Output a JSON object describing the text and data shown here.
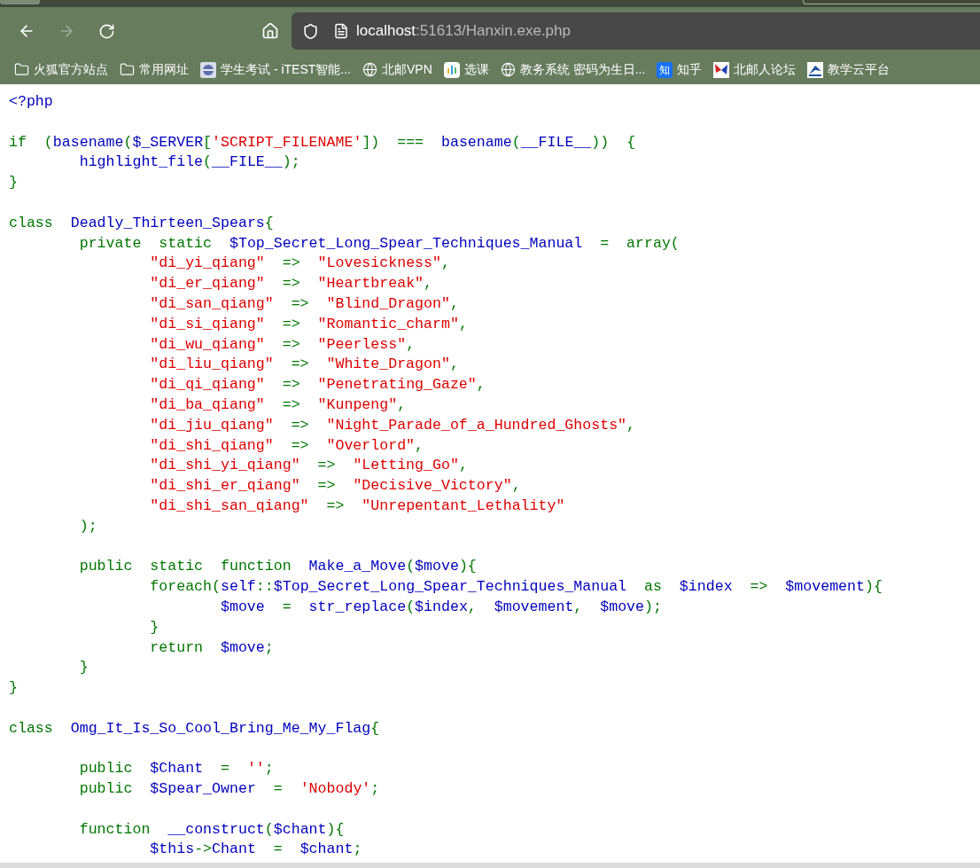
{
  "toolbar": {
    "back": {
      "disabled": false
    },
    "forward": {
      "disabled": true
    },
    "url": {
      "host": "localhost",
      "rest": ":51613/Hanxin.exe.php"
    }
  },
  "bookmarks": [
    {
      "kind": "folder",
      "label": "火狐官方站点"
    },
    {
      "kind": "folder",
      "label": "常用网址"
    },
    {
      "kind": "itest",
      "label": "学生考试 - iTEST智能..."
    },
    {
      "kind": "globe",
      "label": "北邮VPN"
    },
    {
      "kind": "bars",
      "label": "选课"
    },
    {
      "kind": "globe",
      "label": "教务系统 密码为生日..."
    },
    {
      "kind": "zhihu",
      "icon_text": "知",
      "label": "知乎"
    },
    {
      "kind": "butterfly",
      "label": "北邮人论坛"
    },
    {
      "kind": "bird",
      "label": "教学云平台"
    }
  ],
  "code_lines": [
    {
      "kind": "code",
      "tokens": [
        {
          "kind": "default",
          "text": "<?php"
        }
      ]
    },
    {
      "kind": "blank"
    },
    {
      "kind": "code",
      "tokens": [
        {
          "kind": "keyword",
          "text": "if  ("
        },
        {
          "kind": "default",
          "text": "basename"
        },
        {
          "kind": "keyword",
          "text": "("
        },
        {
          "kind": "default",
          "text": "$_SERVER"
        },
        {
          "kind": "keyword",
          "text": "["
        },
        {
          "kind": "string",
          "text": "'SCRIPT_FILENAME'"
        },
        {
          "kind": "keyword",
          "text": "])  ===  "
        },
        {
          "kind": "default",
          "text": "basename"
        },
        {
          "kind": "keyword",
          "text": "("
        },
        {
          "kind": "default",
          "text": "__FILE__"
        },
        {
          "kind": "keyword",
          "text": "))  {"
        }
      ]
    },
    {
      "kind": "code",
      "tokens": [
        {
          "kind": "default",
          "text": "\thighlight_file"
        },
        {
          "kind": "keyword",
          "text": "("
        },
        {
          "kind": "default",
          "text": "__FILE__"
        },
        {
          "kind": "keyword",
          "text": ");"
        }
      ]
    },
    {
      "kind": "code",
      "tokens": [
        {
          "kind": "keyword",
          "text": "}"
        }
      ]
    },
    {
      "kind": "blank"
    },
    {
      "kind": "code",
      "tokens": [
        {
          "kind": "keyword",
          "text": "class  "
        },
        {
          "kind": "default",
          "text": "Deadly_Thirteen_Spears"
        },
        {
          "kind": "keyword",
          "text": "{"
        }
      ]
    },
    {
      "kind": "code",
      "tokens": [
        {
          "kind": "keyword",
          "text": "\tprivate  static  "
        },
        {
          "kind": "default",
          "text": "$Top_Secret_Long_Spear_Techniques_Manual  "
        },
        {
          "kind": "keyword",
          "text": "=  array("
        }
      ]
    },
    {
      "kind": "code",
      "tokens": [
        {
          "kind": "string",
          "text": "\t\t\"di_yi_qiang\"  "
        },
        {
          "kind": "keyword",
          "text": "=>  "
        },
        {
          "kind": "string",
          "text": "\"Lovesickness\""
        },
        {
          "kind": "keyword",
          "text": ","
        }
      ]
    },
    {
      "kind": "code",
      "tokens": [
        {
          "kind": "string",
          "text": "\t\t\"di_er_qiang\"  "
        },
        {
          "kind": "keyword",
          "text": "=>  "
        },
        {
          "kind": "string",
          "text": "\"Heartbreak\""
        },
        {
          "kind": "keyword",
          "text": ","
        }
      ]
    },
    {
      "kind": "code",
      "tokens": [
        {
          "kind": "string",
          "text": "\t\t\"di_san_qiang\"  "
        },
        {
          "kind": "keyword",
          "text": "=>  "
        },
        {
          "kind": "string",
          "text": "\"Blind_Dragon\""
        },
        {
          "kind": "keyword",
          "text": ","
        }
      ]
    },
    {
      "kind": "code",
      "tokens": [
        {
          "kind": "string",
          "text": "\t\t\"di_si_qiang\"  "
        },
        {
          "kind": "keyword",
          "text": "=>  "
        },
        {
          "kind": "string",
          "text": "\"Romantic_charm\""
        },
        {
          "kind": "keyword",
          "text": ","
        }
      ]
    },
    {
      "kind": "code",
      "tokens": [
        {
          "kind": "string",
          "text": "\t\t\"di_wu_qiang\"  "
        },
        {
          "kind": "keyword",
          "text": "=>  "
        },
        {
          "kind": "string",
          "text": "\"Peerless\""
        },
        {
          "kind": "keyword",
          "text": ","
        }
      ]
    },
    {
      "kind": "code",
      "tokens": [
        {
          "kind": "string",
          "text": "\t\t\"di_liu_qiang\"  "
        },
        {
          "kind": "keyword",
          "text": "=>  "
        },
        {
          "kind": "string",
          "text": "\"White_Dragon\""
        },
        {
          "kind": "keyword",
          "text": ","
        }
      ]
    },
    {
      "kind": "code",
      "tokens": [
        {
          "kind": "string",
          "text": "\t\t\"di_qi_qiang\"  "
        },
        {
          "kind": "keyword",
          "text": "=>  "
        },
        {
          "kind": "string",
          "text": "\"Penetrating_Gaze\""
        },
        {
          "kind": "keyword",
          "text": ","
        }
      ]
    },
    {
      "kind": "code",
      "tokens": [
        {
          "kind": "string",
          "text": "\t\t\"di_ba_qiang\"  "
        },
        {
          "kind": "keyword",
          "text": "=>  "
        },
        {
          "kind": "string",
          "text": "\"Kunpeng\""
        },
        {
          "kind": "keyword",
          "text": ","
        }
      ]
    },
    {
      "kind": "code",
      "tokens": [
        {
          "kind": "string",
          "text": "\t\t\"di_jiu_qiang\"  "
        },
        {
          "kind": "keyword",
          "text": "=>  "
        },
        {
          "kind": "string",
          "text": "\"Night_Parade_of_a_Hundred_Ghosts\""
        },
        {
          "kind": "keyword",
          "text": ","
        }
      ]
    },
    {
      "kind": "code",
      "tokens": [
        {
          "kind": "string",
          "text": "\t\t\"di_shi_qiang\"  "
        },
        {
          "kind": "keyword",
          "text": "=>  "
        },
        {
          "kind": "string",
          "text": "\"Overlord\""
        },
        {
          "kind": "keyword",
          "text": ","
        }
      ]
    },
    {
      "kind": "code",
      "tokens": [
        {
          "kind": "string",
          "text": "\t\t\"di_shi_yi_qiang\"  "
        },
        {
          "kind": "keyword",
          "text": "=>  "
        },
        {
          "kind": "string",
          "text": "\"Letting_Go\""
        },
        {
          "kind": "keyword",
          "text": ","
        }
      ]
    },
    {
      "kind": "code",
      "tokens": [
        {
          "kind": "string",
          "text": "\t\t\"di_shi_er_qiang\"  "
        },
        {
          "kind": "keyword",
          "text": "=>  "
        },
        {
          "kind": "string",
          "text": "\"Decisive_Victory\""
        },
        {
          "kind": "keyword",
          "text": ","
        }
      ]
    },
    {
      "kind": "code",
      "tokens": [
        {
          "kind": "string",
          "text": "\t\t\"di_shi_san_qiang\"  "
        },
        {
          "kind": "keyword",
          "text": "=>  "
        },
        {
          "kind": "string",
          "text": "\"Unrepentant_Lethality\""
        }
      ]
    },
    {
      "kind": "code",
      "tokens": [
        {
          "kind": "keyword",
          "text": "\t);"
        }
      ]
    },
    {
      "kind": "blank"
    },
    {
      "kind": "code",
      "tokens": [
        {
          "kind": "keyword",
          "text": "\tpublic  static  function  "
        },
        {
          "kind": "default",
          "text": "Make_a_Move"
        },
        {
          "kind": "keyword",
          "text": "("
        },
        {
          "kind": "default",
          "text": "$move"
        },
        {
          "kind": "keyword",
          "text": "){"
        }
      ]
    },
    {
      "kind": "code",
      "tokens": [
        {
          "kind": "keyword",
          "text": "\t\tforeach("
        },
        {
          "kind": "default",
          "text": "self"
        },
        {
          "kind": "keyword",
          "text": "::"
        },
        {
          "kind": "default",
          "text": "$Top_Secret_Long_Spear_Techniques_Manual  "
        },
        {
          "kind": "keyword",
          "text": "as  "
        },
        {
          "kind": "default",
          "text": "$index  "
        },
        {
          "kind": "keyword",
          "text": "=>  "
        },
        {
          "kind": "default",
          "text": "$movement"
        },
        {
          "kind": "keyword",
          "text": "){"
        }
      ]
    },
    {
      "kind": "code",
      "tokens": [
        {
          "kind": "default",
          "text": "\t\t\t$move  "
        },
        {
          "kind": "keyword",
          "text": "=  "
        },
        {
          "kind": "default",
          "text": "str_replace"
        },
        {
          "kind": "keyword",
          "text": "("
        },
        {
          "kind": "default",
          "text": "$index"
        },
        {
          "kind": "keyword",
          "text": ",  "
        },
        {
          "kind": "default",
          "text": "$movement"
        },
        {
          "kind": "keyword",
          "text": ",  "
        },
        {
          "kind": "default",
          "text": "$move"
        },
        {
          "kind": "keyword",
          "text": ");"
        }
      ]
    },
    {
      "kind": "code",
      "tokens": [
        {
          "kind": "keyword",
          "text": "\t\t}"
        }
      ]
    },
    {
      "kind": "code",
      "tokens": [
        {
          "kind": "keyword",
          "text": "\t\treturn  "
        },
        {
          "kind": "default",
          "text": "$move"
        },
        {
          "kind": "keyword",
          "text": ";"
        }
      ]
    },
    {
      "kind": "code",
      "tokens": [
        {
          "kind": "keyword",
          "text": "\t}"
        }
      ]
    },
    {
      "kind": "code",
      "tokens": [
        {
          "kind": "keyword",
          "text": "}"
        }
      ]
    },
    {
      "kind": "blank"
    },
    {
      "kind": "code",
      "tokens": [
        {
          "kind": "keyword",
          "text": "class  "
        },
        {
          "kind": "default",
          "text": "Omg_It_Is_So_Cool_Bring_Me_My_Flag"
        },
        {
          "kind": "keyword",
          "text": "{"
        }
      ]
    },
    {
      "kind": "blank"
    },
    {
      "kind": "code",
      "tokens": [
        {
          "kind": "keyword",
          "text": "\tpublic  "
        },
        {
          "kind": "default",
          "text": "$Chant  "
        },
        {
          "kind": "keyword",
          "text": "=  "
        },
        {
          "kind": "string",
          "text": "''"
        },
        {
          "kind": "keyword",
          "text": ";"
        }
      ]
    },
    {
      "kind": "code",
      "tokens": [
        {
          "kind": "keyword",
          "text": "\tpublic  "
        },
        {
          "kind": "default",
          "text": "$Spear_Owner  "
        },
        {
          "kind": "keyword",
          "text": "=  "
        },
        {
          "kind": "string",
          "text": "'Nobody'"
        },
        {
          "kind": "keyword",
          "text": ";"
        }
      ]
    },
    {
      "kind": "blank"
    },
    {
      "kind": "code",
      "tokens": [
        {
          "kind": "keyword",
          "text": "\tfunction  "
        },
        {
          "kind": "default",
          "text": "__construct"
        },
        {
          "kind": "keyword",
          "text": "("
        },
        {
          "kind": "default",
          "text": "$chant"
        },
        {
          "kind": "keyword",
          "text": "){"
        }
      ]
    },
    {
      "kind": "code",
      "tokens": [
        {
          "kind": "default",
          "text": "\t\t$this"
        },
        {
          "kind": "keyword",
          "text": "->"
        },
        {
          "kind": "default",
          "text": "Chant  "
        },
        {
          "kind": "keyword",
          "text": "=  "
        },
        {
          "kind": "default",
          "text": "$chant"
        },
        {
          "kind": "keyword",
          "text": ";"
        }
      ]
    }
  ]
}
